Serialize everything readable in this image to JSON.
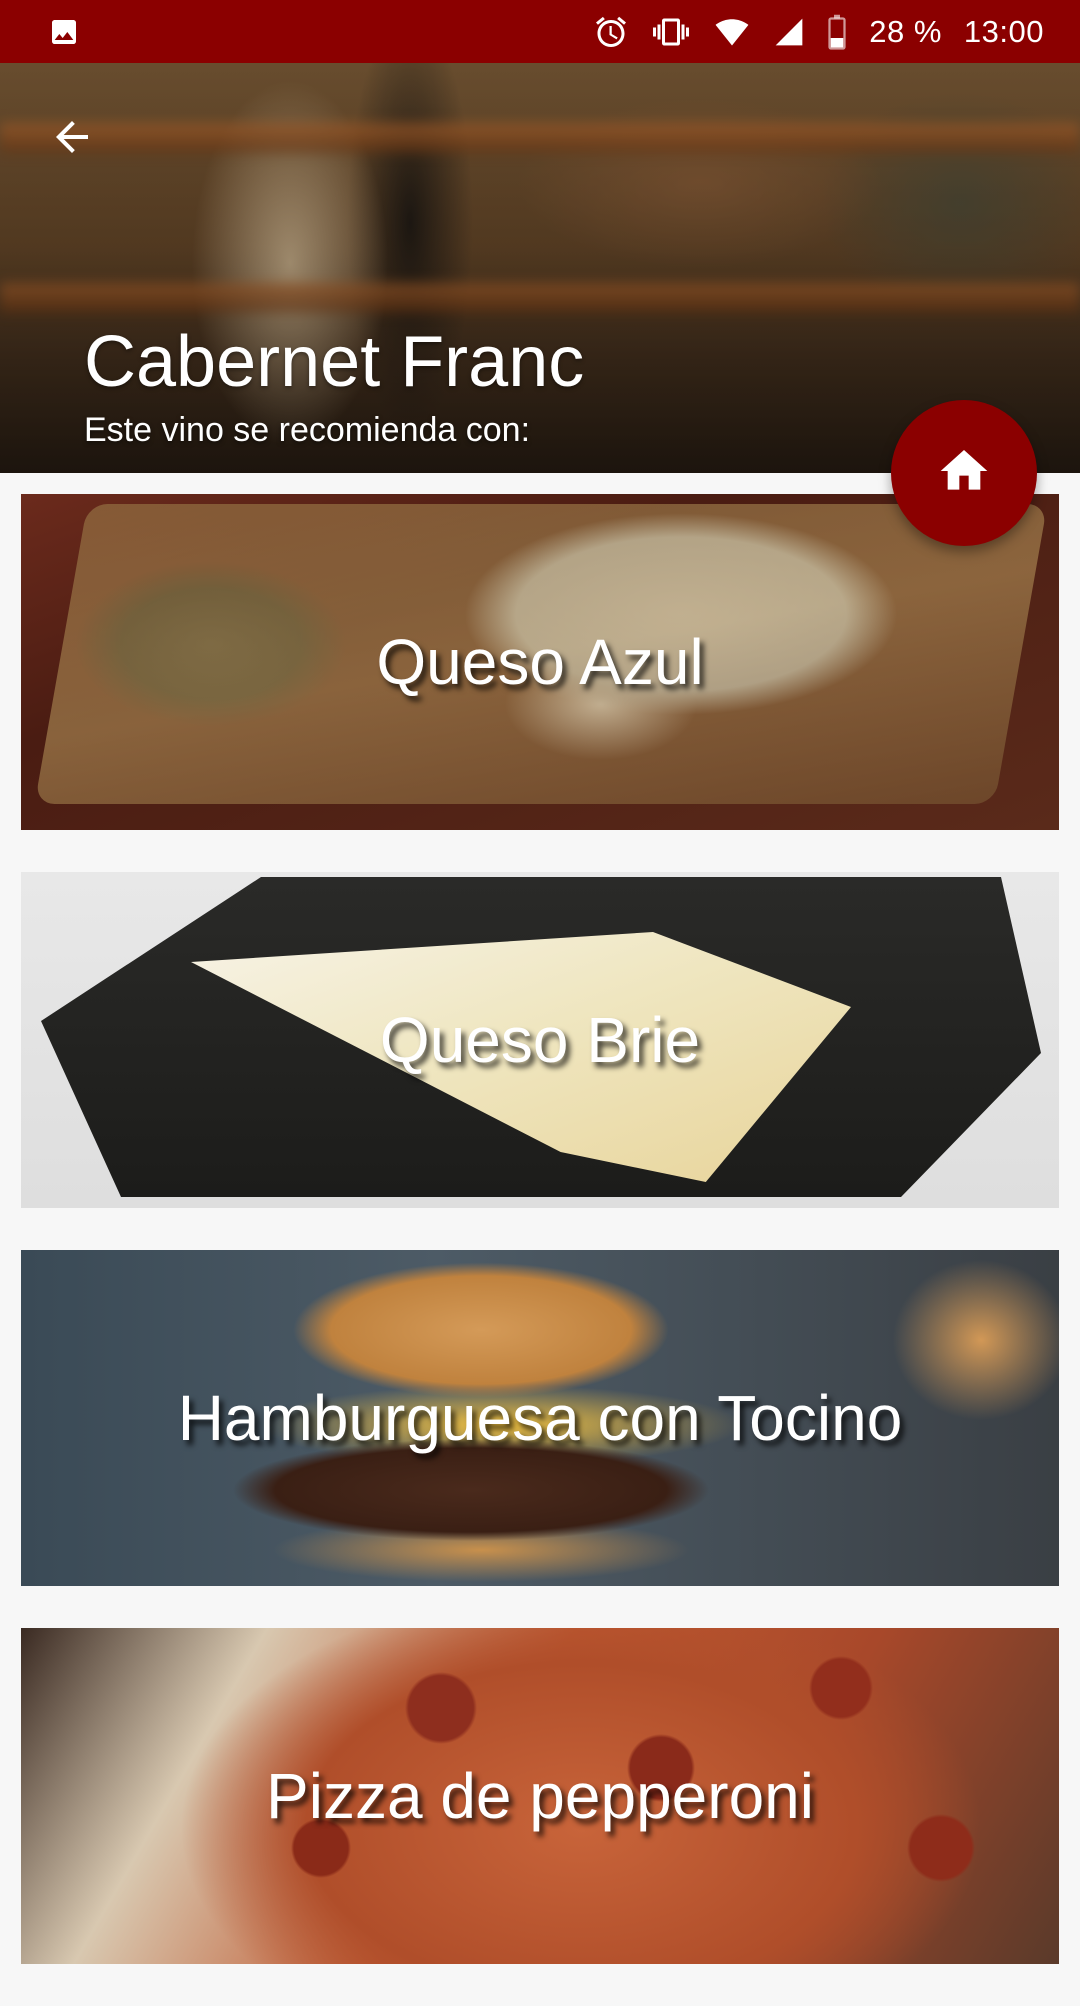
{
  "status_bar": {
    "battery": "28 %",
    "time": "13:00",
    "icons": [
      "image-icon",
      "alarm-icon",
      "vibrate-icon",
      "wifi-icon",
      "signal-icon",
      "battery-icon"
    ]
  },
  "header": {
    "title": "Cabernet Franc",
    "subtitle": "Este vino se recomienda con:",
    "back_icon": "arrow-left-icon"
  },
  "fab": {
    "icon": "home-icon",
    "color": "#8b0000"
  },
  "pairings": [
    {
      "label": "Queso Azul"
    },
    {
      "label": "Queso Brie"
    },
    {
      "label": "Hamburguesa con Tocino"
    },
    {
      "label": "Pizza de pepperoni"
    }
  ],
  "colors": {
    "accent": "#8b0000",
    "background": "#f7f7f7"
  }
}
